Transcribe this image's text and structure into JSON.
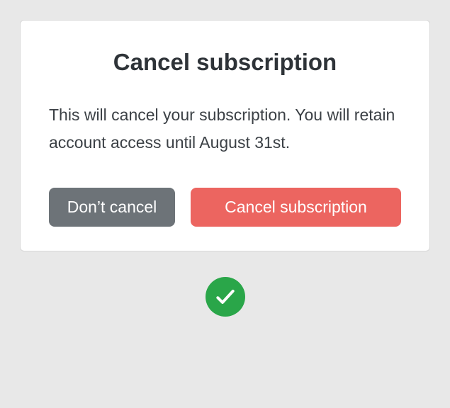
{
  "modal": {
    "title": "Cancel subscription",
    "body": "This will cancel your subscription. You will retain account access until August 31st.",
    "buttons": {
      "dont_cancel": "Don’t cancel",
      "cancel_subscription": "Cancel subscription"
    }
  },
  "status": {
    "icon": "checkmark",
    "color": "#2aa649"
  }
}
